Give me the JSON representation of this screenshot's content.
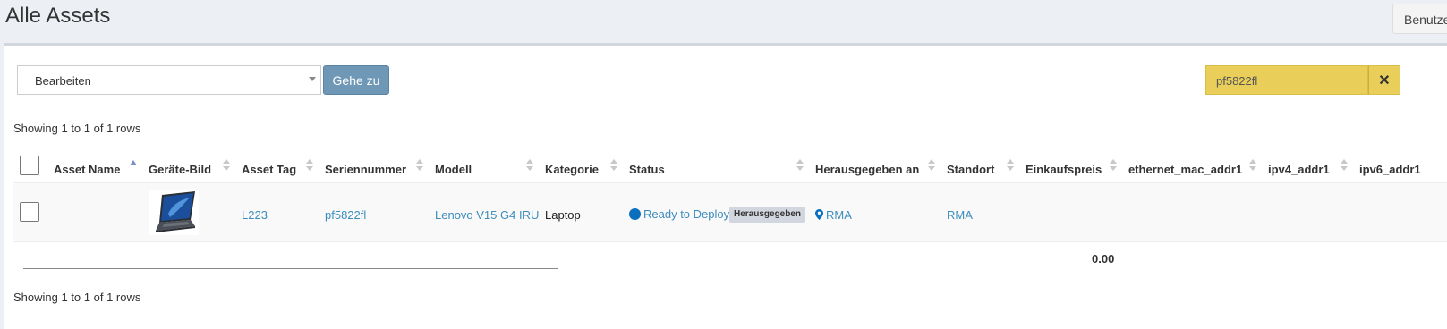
{
  "header": {
    "title": "Alle Assets",
    "top_button_label": "Benutze"
  },
  "toolbar": {
    "bulk_action_selected": "Bearbeiten",
    "go_button_label": "Gehe zu",
    "search_value": "pf5822fl",
    "clear_search_symbol": "✕"
  },
  "pagination": {
    "info_top": "Showing 1 to 1 of 1 rows",
    "info_bottom": "Showing 1 to 1 of 1 rows"
  },
  "table": {
    "columns": [
      "Asset Name",
      "Geräte-Bild",
      "Asset Tag",
      "Seriennummer",
      "Modell",
      "Kategorie",
      "Status",
      "Herausgegeben an",
      "Standort",
      "Einkaufspreis",
      "ethernet_mac_addr1",
      "ipv4_addr1",
      "ipv6_addr1"
    ],
    "sorted_column": "Asset Name",
    "rows": [
      {
        "asset_name": "",
        "image_icon": "laptop-image",
        "asset_tag": "L223",
        "serial": "pf5822fl",
        "model": "Lenovo V15 G4 IRU",
        "category": "Laptop",
        "status": "Ready to Deploy",
        "status_badge": "Herausgegeben",
        "assigned_to": "RMA",
        "assigned_icon": "map-marker-icon",
        "location": "RMA",
        "purchase_price": "",
        "ethernet_mac_addr1": "",
        "ipv4_addr1": "",
        "ipv6_addr1": ""
      }
    ],
    "footer_total": "0.00"
  },
  "colors": {
    "link": "#3c8dbc",
    "status_dot": "#0a6fbd",
    "search_highlight": "#e9ce5a",
    "go_button": "#6f97b6"
  }
}
